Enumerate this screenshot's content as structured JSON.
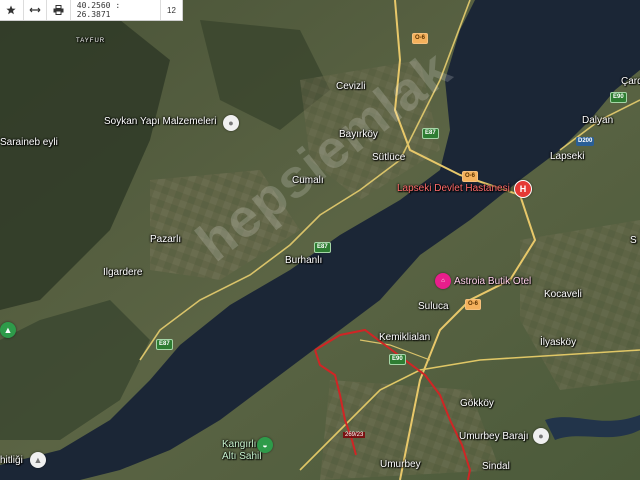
{
  "toolbar": {
    "coords": "40.2560 : 26.3871",
    "zoom": "12"
  },
  "watermark": "hepsiemlak",
  "places": {
    "tayfur": "TAYFUR",
    "cevizli": "Cevizli",
    "bayirkoy": "Bayırköy",
    "sutluce": "Sütlüce",
    "cumali": "Cumalı",
    "saraineb": "Saraineb eyli",
    "pazarli": "Pazarlı",
    "ilgardere": "Ilgardere",
    "burhanli": "Burhanlı",
    "lapseki": "Lapseki",
    "dalyan": "Dalyan",
    "carda": "Çard",
    "suluca": "Suluca",
    "kocaveli": "Kocaveli",
    "kemiklialan": "Kemiklialan",
    "ilyaskoy": "İlyasköy",
    "gokkoy": "Gökköy",
    "umurbey": "Umurbey",
    "sindal": "Sindal",
    "hitligi": "hitliği",
    "right_s": "S"
  },
  "pois": {
    "soykan": "Soykan Yapı Malzemeleri",
    "hastane": "Lapseki Devlet Hastanesi",
    "astroia": "Astroia Butik Otel",
    "kangirli_1": "Kangırlı",
    "kangirli_2": "Altı Sahil",
    "baraji": "Umurbey Barajı"
  },
  "roads": {
    "o6_a": "O-6",
    "o6_b": "O-6",
    "o6_c": "O-6",
    "e87_a": "E87",
    "e87_b": "E87",
    "e87_c": "E87",
    "e90_a": "E90",
    "e90_b": "E90",
    "d200": "D200"
  },
  "parcel": "269/23",
  "colors": {
    "water": "#1b2636",
    "land": "#4d5a3a",
    "road": "#e8c86a",
    "parcel": "#d02525"
  }
}
